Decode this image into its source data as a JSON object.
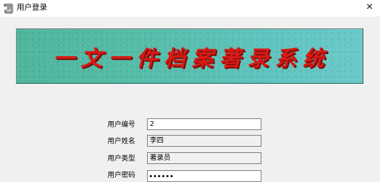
{
  "window": {
    "title": "用户登录",
    "icon": "document-scroll-icon",
    "close_label": "✕"
  },
  "banner": {
    "text": "一文一件档案著录系统",
    "text_color": "#d81a16",
    "bg_color_start": "#4fb59d",
    "bg_color_end": "#6ac9c9"
  },
  "form": {
    "user_id": {
      "label": "用户编号",
      "value": "2"
    },
    "user_name": {
      "label": "用户姓名",
      "value": "李四"
    },
    "user_type": {
      "label": "用户类型",
      "value": "著录员"
    },
    "password": {
      "label": "用户密码",
      "masked_chars": 6
    }
  }
}
